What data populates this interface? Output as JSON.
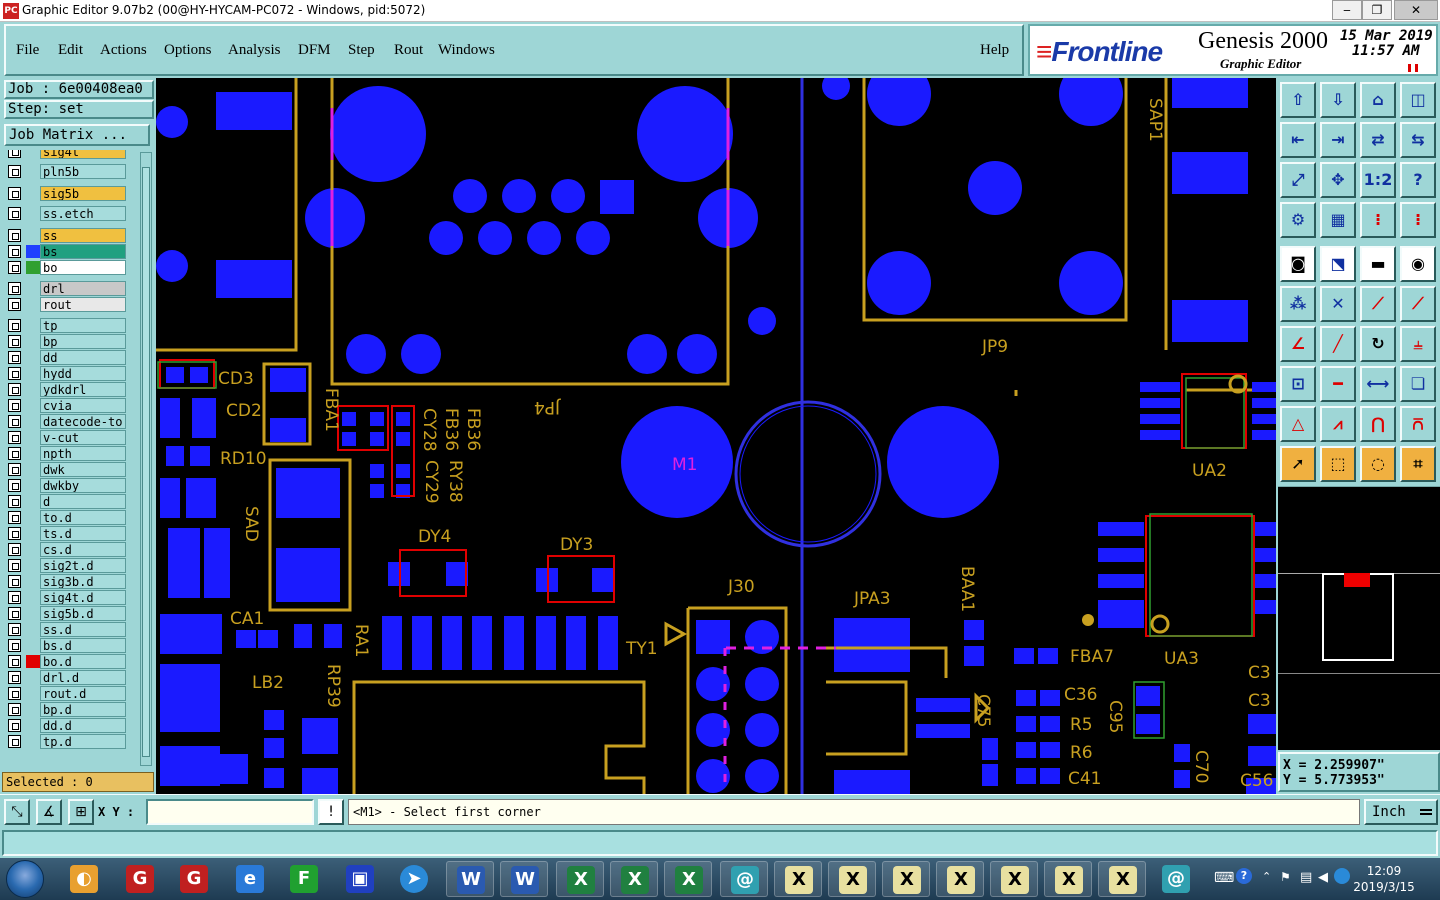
{
  "window": {
    "title": "Graphic Editor 9.07b2 (00@HY-HYCAM-PC072 - Windows, pid:5072)",
    "app_icon_text": "PC"
  },
  "menu": {
    "items": [
      "File",
      "Edit",
      "Actions",
      "Options",
      "Analysis",
      "DFM",
      "Step",
      "Rout",
      "Windows"
    ],
    "help": "Help"
  },
  "brand": {
    "logo": "Frontline",
    "product": "Genesis 2000",
    "subtitle": "Graphic Editor",
    "date": "15 Mar 2019",
    "time": "11:57 AM"
  },
  "job": {
    "job_label": "Job  : 6e00408ea0",
    "step_label": "Step: set",
    "matrix_button": "Job Matrix ..."
  },
  "layers": [
    {
      "name": "sig4t",
      "color": "#f0c040"
    },
    {
      "name": "pln5b",
      "color": "#a6dcdc"
    },
    {
      "name": "sig5b",
      "color": "#f0c040"
    },
    {
      "name": "ss.etch",
      "color": "#a6dcdc"
    },
    {
      "name": "ss",
      "color": "#f0c040"
    },
    {
      "name": "bs",
      "color": "#20a080",
      "swatch": "#2040ff"
    },
    {
      "name": "bo",
      "color": "#ffffff",
      "swatch": "#30a030"
    },
    {
      "name": "drl",
      "color": "#c8c8c8"
    },
    {
      "name": "rout",
      "color": "#e8e8e8"
    },
    {
      "name": "tp",
      "color": "#a6dcdc"
    },
    {
      "name": "bp",
      "color": "#a6dcdc"
    },
    {
      "name": "dd",
      "color": "#a6dcdc"
    },
    {
      "name": "hydd",
      "color": "#a6dcdc"
    },
    {
      "name": "ydkdrl",
      "color": "#a6dcdc"
    },
    {
      "name": "cvia",
      "color": "#a6dcdc"
    },
    {
      "name": "datecode-to",
      "color": "#a6dcdc"
    },
    {
      "name": "v-cut",
      "color": "#a6dcdc"
    },
    {
      "name": "npth",
      "color": "#a6dcdc"
    },
    {
      "name": "dwk",
      "color": "#a6dcdc"
    },
    {
      "name": "dwkby",
      "color": "#a6dcdc"
    },
    {
      "name": "d",
      "color": "#a6dcdc"
    },
    {
      "name": "to.d",
      "color": "#a6dcdc"
    },
    {
      "name": "ts.d",
      "color": "#a6dcdc"
    },
    {
      "name": "cs.d",
      "color": "#a6dcdc"
    },
    {
      "name": "sig2t.d",
      "color": "#a6dcdc"
    },
    {
      "name": "sig3b.d",
      "color": "#a6dcdc"
    },
    {
      "name": "sig4t.d",
      "color": "#a6dcdc"
    },
    {
      "name": "sig5b.d",
      "color": "#a6dcdc"
    },
    {
      "name": "ss.d",
      "color": "#a6dcdc"
    },
    {
      "name": "bs.d",
      "color": "#a6dcdc"
    },
    {
      "name": "bo.d",
      "color": "#a6dcdc",
      "swatch": "#e00000"
    },
    {
      "name": "drl.d",
      "color": "#a6dcdc"
    },
    {
      "name": "rout.d",
      "color": "#a6dcdc"
    },
    {
      "name": "bp.d",
      "color": "#a6dcdc"
    },
    {
      "name": "dd.d",
      "color": "#a6dcdc"
    },
    {
      "name": "tp.d",
      "color": "#a6dcdc"
    }
  ],
  "selected": "Selected : 0",
  "coordinates": {
    "x": "X = 2.259907\"",
    "y": "Y = 5.773953\""
  },
  "command": {
    "xy_label": "X Y :",
    "xy_value": "",
    "prompt": "<M1> - Select first corner",
    "units": "Inch"
  },
  "pcb_labels": {
    "cd3": "CD3",
    "cd2": "CD2",
    "rd10": "RD10",
    "fba1": "FBA1",
    "cy28": "CY28",
    "fb36": "FB36",
    "cy29": "CY29",
    "ry38": "RY38",
    "jp4": "JP4",
    "m1": "M1",
    "jp9": "JP9",
    "sap1": "SAP1",
    "ua2": "UA2",
    "dy4": "DY4",
    "dy3": "DY3",
    "sad": "SAD",
    "ca1": "CA1",
    "ra1": "RA1",
    "lb2": "LB2",
    "rp39": "RP39",
    "ty1": "TY1",
    "j30": "J30",
    "jpa3": "JPA3",
    "baa1": "BAA1",
    "fba7": "FBA7",
    "ua3": "UA3",
    "c36": "C36",
    "r5": "R5",
    "r6": "R6",
    "c41": "C41",
    "c95": "C95",
    "c70": "C70",
    "c75": "C75",
    "c3a": "C3",
    "c3b": "C3",
    "c56": "C56"
  },
  "taskbar": {
    "clock_time": "12:09",
    "clock_date": "2019/3/15"
  },
  "colors": {
    "pad": "#1a1aff",
    "silk": "#c8a020",
    "outline_red": "#e00000",
    "outline_green": "#30a030",
    "route": "#3030e0",
    "drill_mark": "#e020e0",
    "panel": "#9ed6d6"
  }
}
